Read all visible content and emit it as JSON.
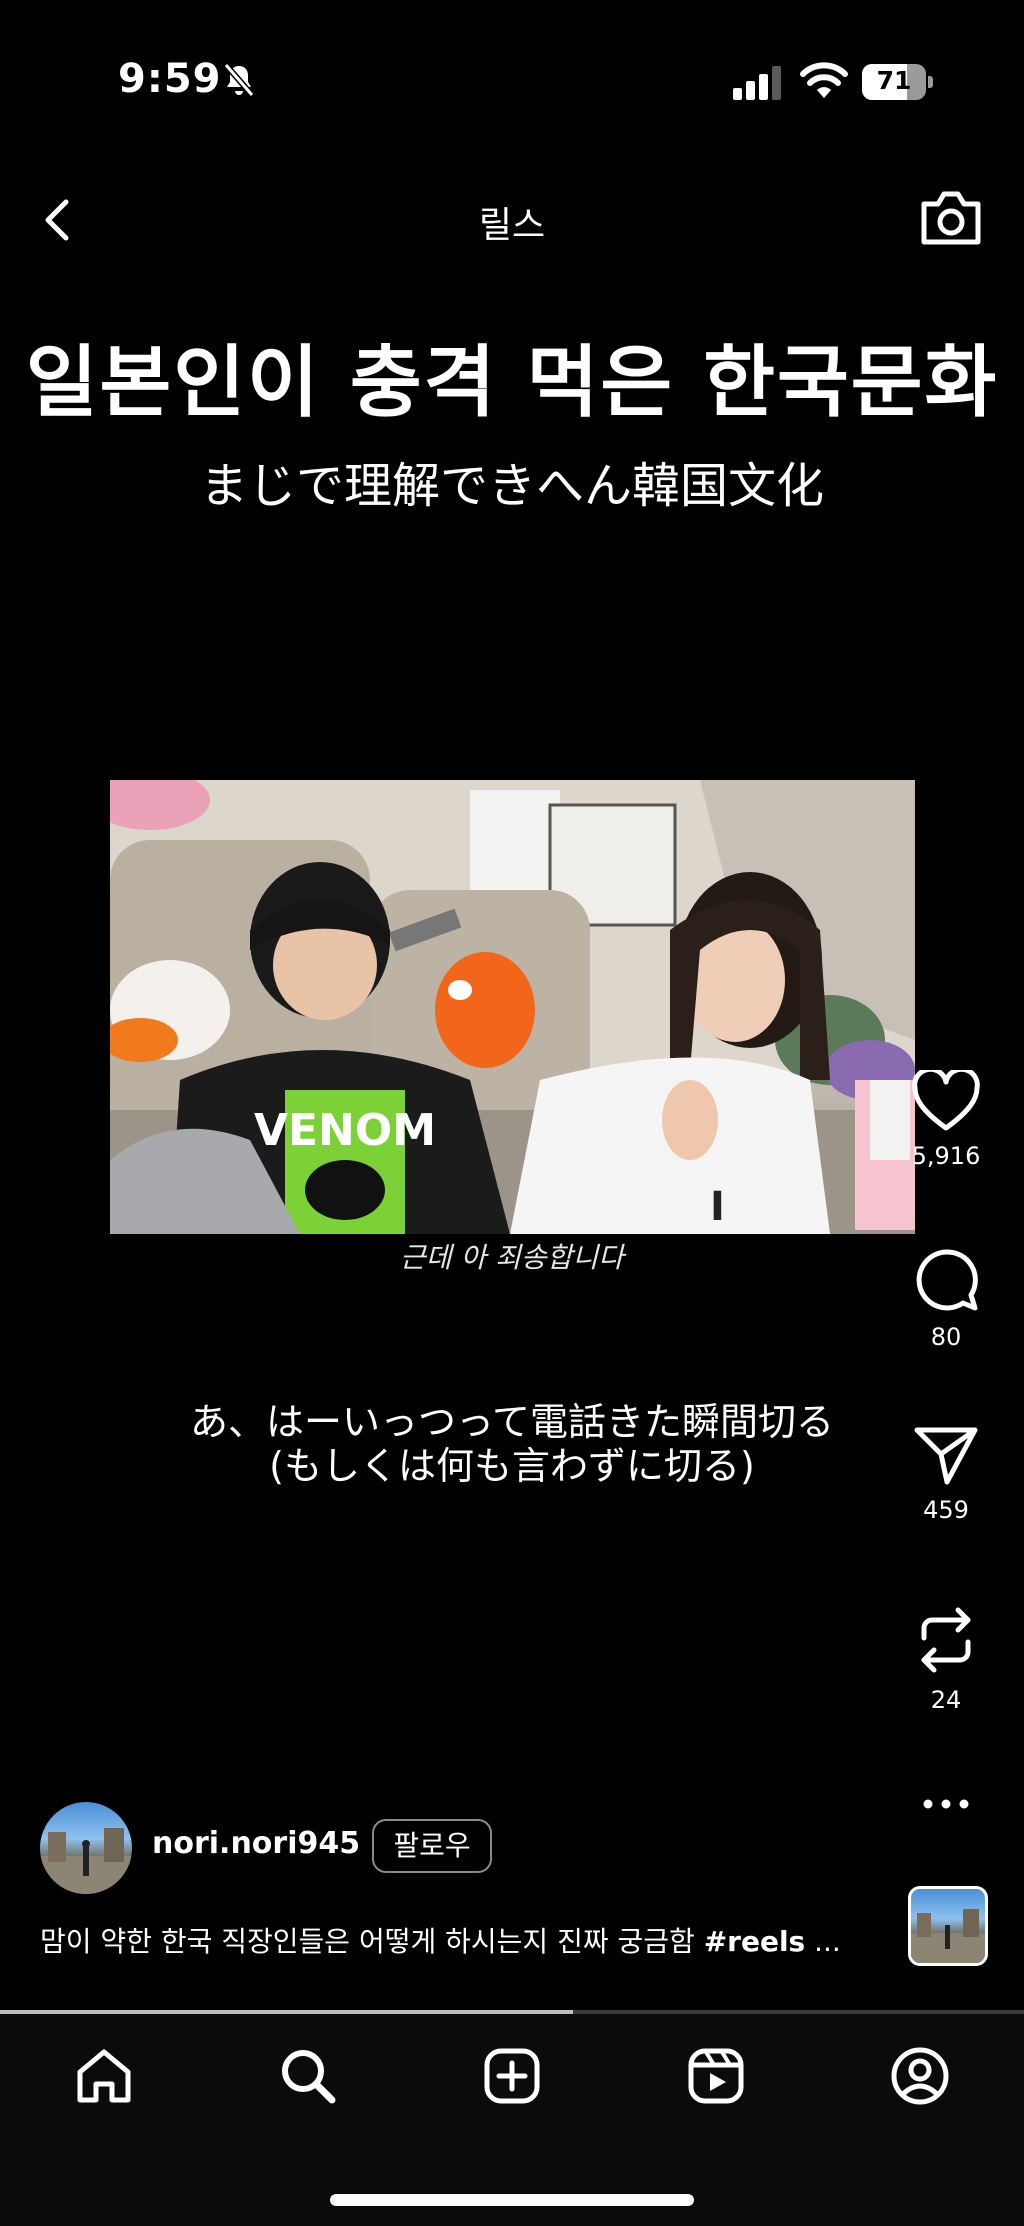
{
  "status_bar": {
    "time": "9:59",
    "silent_icon": "bell-slash-icon",
    "signal_icon": "cellular-signal-icon",
    "wifi_icon": "wifi-icon",
    "battery_level": "71"
  },
  "header": {
    "back_icon": "chevron-left-icon",
    "title": "릴스",
    "camera_icon": "camera-icon"
  },
  "video": {
    "title_overlay": "일본인이 충격 먹은 한국문화",
    "subtitle_overlay": "まじで理解できへん韓国文化",
    "inline_caption": "근데 아 죄송합니다",
    "caption_line1": "あ、はーいっつって電話きた瞬間切る",
    "caption_line2": "(もしくは何も言わずに切る)"
  },
  "actions": {
    "like": {
      "icon": "heart-icon",
      "count": "5,916"
    },
    "comment": {
      "icon": "comment-icon",
      "count": "80"
    },
    "share": {
      "icon": "paper-plane-icon",
      "count": "459"
    },
    "remix": {
      "icon": "repost-icon",
      "count": "24"
    },
    "more": {
      "icon": "more-horizontal-icon"
    }
  },
  "author": {
    "username": "nori.nori945",
    "follow_label": "팔로우"
  },
  "post_caption": {
    "text": "맘이 약한 한국 직장인들은 어떻게 하시는지 진짜 궁금함 ",
    "hashtag": "#reels",
    "ellipsis": " ..."
  },
  "playback": {
    "progress_fraction": 0.56
  },
  "tab_bar": {
    "items": [
      "home-icon",
      "search-icon",
      "create-icon",
      "reels-icon",
      "profile-icon"
    ]
  }
}
